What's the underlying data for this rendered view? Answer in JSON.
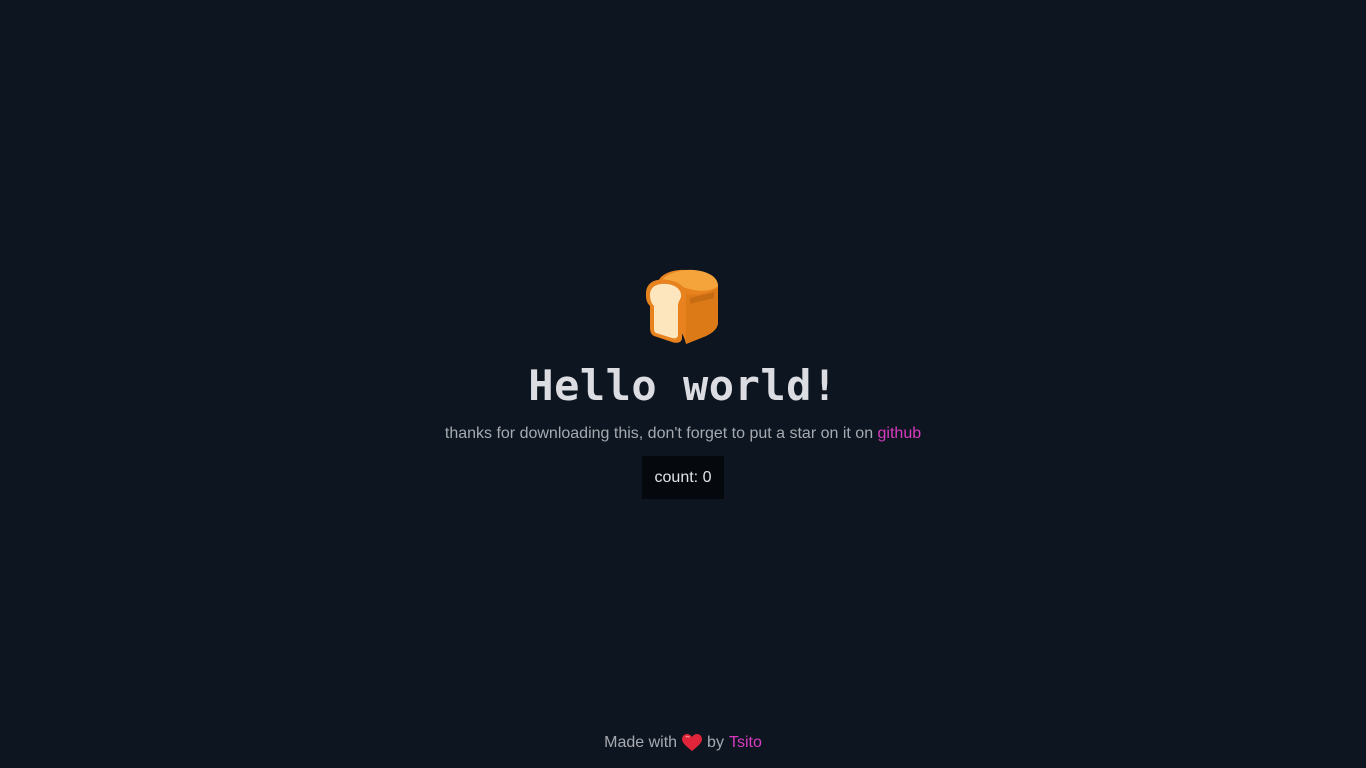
{
  "hero": {
    "icon": "bread-icon",
    "title": "Hello world!",
    "subtitle_text": "thanks for downloading this, don't forget to put a star on it on ",
    "github_label": "github",
    "count_label": "count: 0"
  },
  "footer": {
    "made_with": "Made with",
    "heart_icon": "heart-icon",
    "by": "by",
    "author": "Tsito"
  },
  "colors": {
    "background": "#0d1620",
    "accent": "#d93ac0",
    "button_bg": "#05080c"
  }
}
